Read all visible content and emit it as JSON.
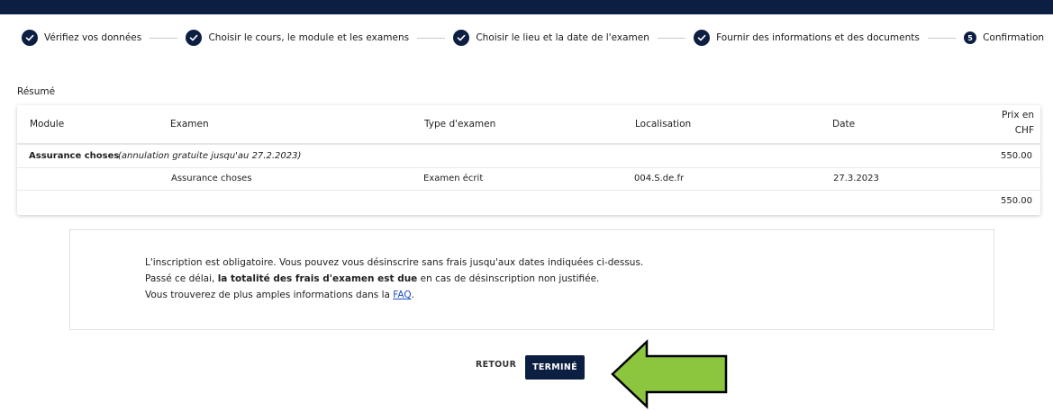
{
  "steps": [
    {
      "label": "Vérifiez vos données",
      "status": "done"
    },
    {
      "label": "Choisir le cours, le module et les examens",
      "status": "done"
    },
    {
      "label": "Choisir le lieu et la date de l'examen",
      "status": "done"
    },
    {
      "label": "Fournir des informations et des documents",
      "status": "done"
    },
    {
      "label": "Confirmation",
      "status": "current",
      "number": "5"
    }
  ],
  "summary": {
    "title": "Résumé",
    "headers": {
      "module": "Module",
      "examen": "Examen",
      "type": "Type d'examen",
      "localisation": "Localisation",
      "date": "Date",
      "prix_line1": "Prix en",
      "prix_line2": "CHF"
    },
    "group": {
      "module": "Assurance choses",
      "note": "(annulation gratuite jusqu'au 27.2.2023)",
      "price": "550.00"
    },
    "row": {
      "examen": "Assurance choses",
      "type": "Examen écrit",
      "localisation": "004.S.de.fr",
      "date": "27.3.2023"
    },
    "total": "550.00"
  },
  "notice": {
    "line1": "L'inscription est obligatoire. Vous pouvez vous désinscrire sans frais jusqu'aux dates indiquées ci-dessus.",
    "line2_pre": "Passé ce délai, ",
    "line2_bold": "la totalité des frais d'examen est due",
    "line2_post": " en cas de désinscription non justifiée.",
    "line3_pre": "Vous trouverez de plus amples informations dans la ",
    "line3_link": "FAQ",
    "line3_post": "."
  },
  "actions": {
    "back_label": "RETOUR",
    "done_label": "TERMINÉ"
  },
  "colors": {
    "primary": "#0c1f42",
    "arrow_fill": "#8cc63f",
    "link": "#1a4fc4"
  }
}
